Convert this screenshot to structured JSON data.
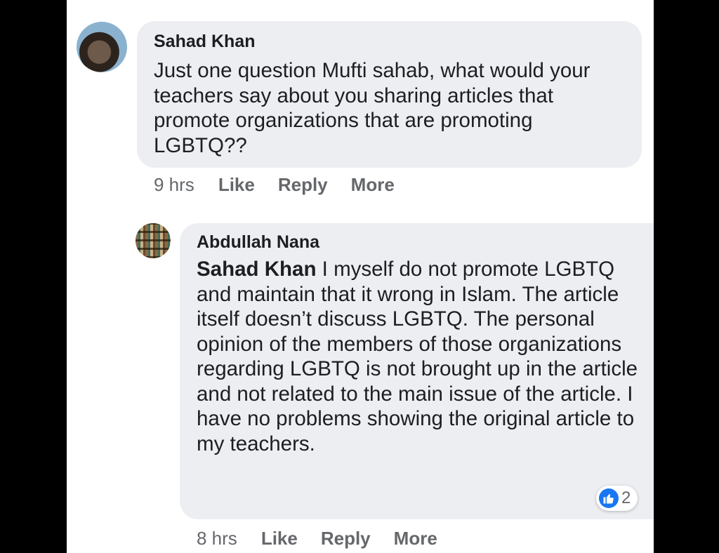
{
  "comments": [
    {
      "author": "Sahad Khan",
      "text": "Just one question Mufti sahab, what would your teachers say about you sharing articles that promote organizations that are promoting LGBTQ??",
      "time": "9 hrs",
      "actions": [
        "Like",
        "Reply",
        "More"
      ]
    },
    {
      "author": "Abdullah Nana",
      "mention": "Sahad Khan",
      "text": " I myself do not promote LGBTQ and maintain that it wrong in Islam. The article itself doesn’t discuss LGBTQ. The personal opinion of the members of those organizations regarding LGBTQ is not brought up in the article and not related to the main issue of the article. I have no problems showing the original article to my teachers.",
      "time": "8 hrs",
      "actions": [
        "Like",
        "Reply",
        "More"
      ],
      "reaction_count": "2",
      "reaction_icon": "like-icon"
    }
  ],
  "colors": {
    "bubble": "#eceef1",
    "like_blue": "#1877f2",
    "meta_gray": "#65676b"
  }
}
